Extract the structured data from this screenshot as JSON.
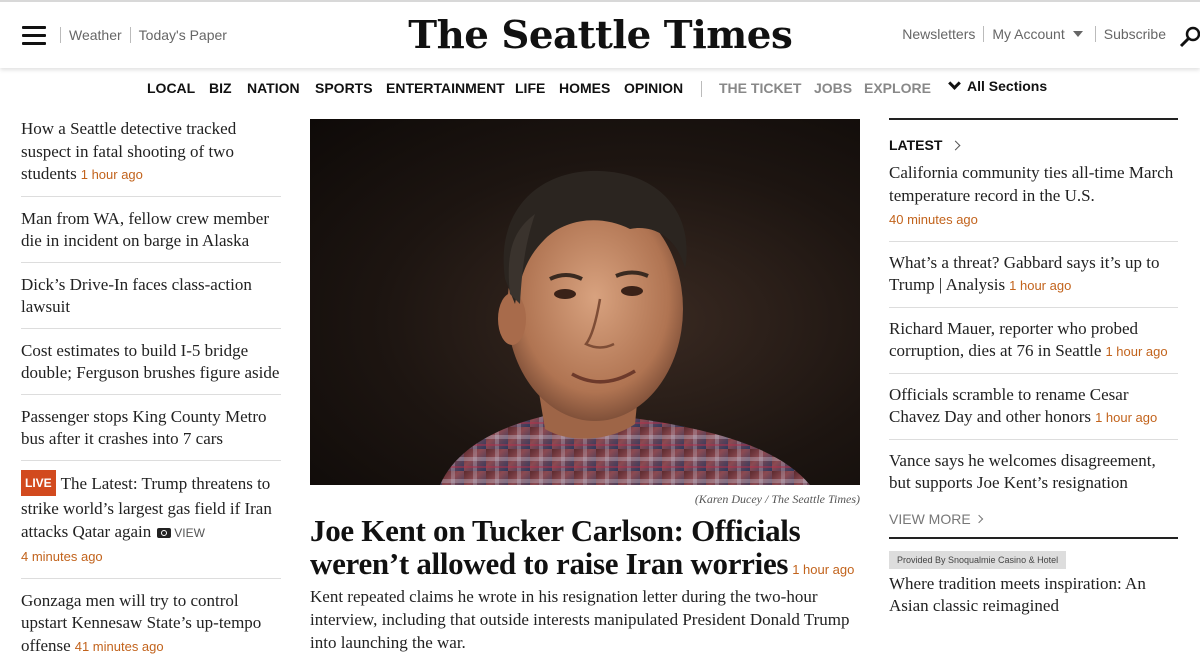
{
  "header": {
    "logo": "The Seattle Times",
    "left_links": [
      "Weather",
      "Today's Paper"
    ],
    "right_links": {
      "newsletters": "Newsletters",
      "account": "My Account",
      "subscribe": "Subscribe"
    }
  },
  "sections": [
    "LOCAL",
    "BIZ",
    "NATION",
    "SPORTS",
    "ENTERTAINMENT",
    "LIFE",
    "HOMES",
    "OPINION"
  ],
  "secondary_sections": [
    "THE TICKET",
    "JOBS",
    "EXPLORE"
  ],
  "all_sections_label": "All Sections",
  "left_stories": [
    {
      "title": "How a Seattle detective tracked suspect in fatal shooting of two students",
      "time": "1 hour ago"
    },
    {
      "title": "Man from WA, fellow crew member die in incident on barge in Alaska"
    },
    {
      "title": "Dick’s Drive-In faces class-action lawsuit"
    },
    {
      "title": "Cost estimates to build I-5 bridge double; Ferguson brushes figure aside"
    },
    {
      "title": "Passenger stops King County Metro bus after it crashes into 7 cars"
    },
    {
      "badge": "LIVE",
      "title": "The Latest: Trump threatens to strike world’s largest gas field if Iran attacks Qatar again",
      "view_label": "VIEW",
      "time": "4 minutes ago"
    },
    {
      "title": "Gonzaga men will try to control upstart Kennesaw State’s up-tempo offense",
      "time": "41 minutes ago"
    }
  ],
  "main": {
    "photo_credit": "(Karen Ducey / The Seattle Times)",
    "headline": "Joe Kent on Tucker Carlson: Officials weren’t allowed to raise Iran worries",
    "time": "1 hour ago",
    "dek": "Kent repeated claims he wrote in his resignation letter during the two-hour interview, including that outside interests manipulated President Donald Trump into launching the war."
  },
  "latest": {
    "heading": "LATEST",
    "stories": [
      {
        "title": "California community ties all-time March temperature record in the U.S.",
        "time": "40 minutes ago"
      },
      {
        "title": "What’s a threat? Gabbard says it’s up to Trump | Analysis",
        "time": "1 hour ago"
      },
      {
        "title": "Richard Mauer, reporter who probed corruption, dies at 76 in Seattle",
        "time": "1 hour ago"
      },
      {
        "title": "Officials scramble to rename Cesar Chavez Day and other honors",
        "time": "1 hour ago"
      },
      {
        "title": "Vance says he welcomes disagreement, but supports Joe Kent’s resignation"
      }
    ],
    "view_more": "VIEW MORE"
  },
  "sponsored": {
    "label": "Provided By Snoqualmie Casino & Hotel",
    "title": "Where tradition meets inspiration: An Asian classic reimagined"
  },
  "colors": {
    "accent": "#c2631c",
    "live_badge": "#d24a1e"
  }
}
